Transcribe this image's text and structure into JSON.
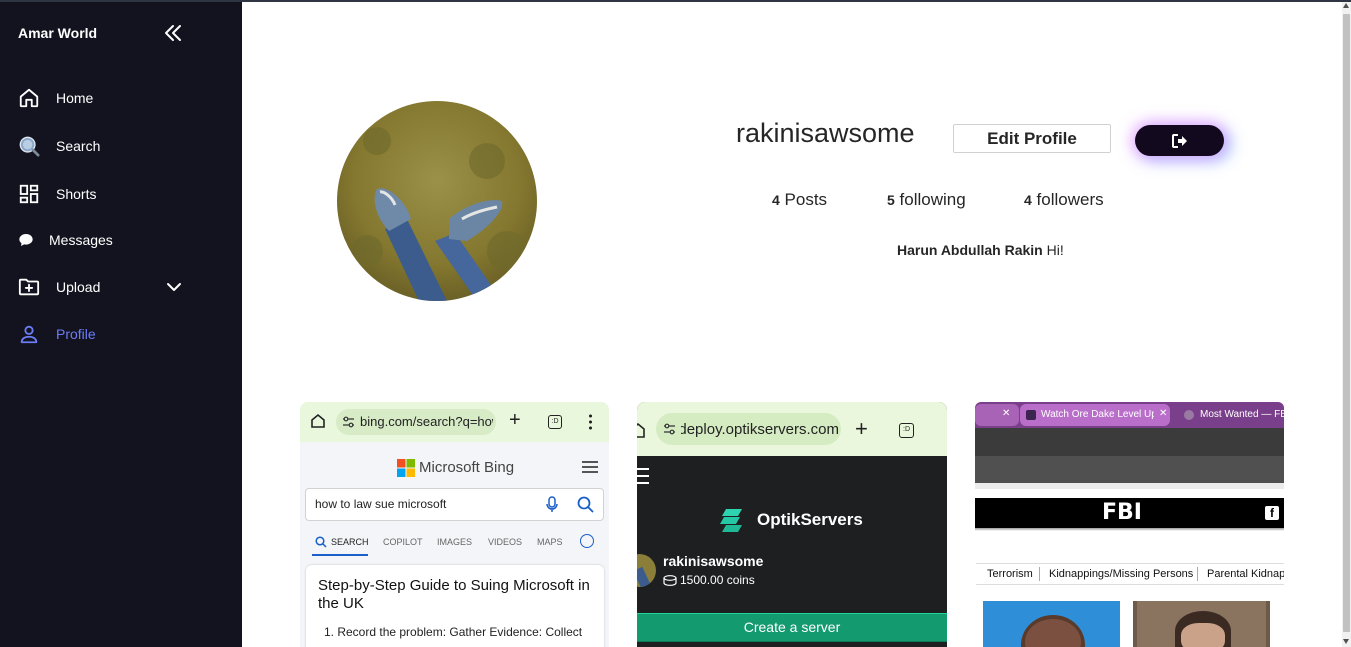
{
  "sidebar": {
    "brand": "Amar World",
    "items": [
      {
        "label": "Home",
        "icon": "home-icon"
      },
      {
        "label": "Search",
        "icon": "search-icon"
      },
      {
        "label": "Shorts",
        "icon": "grid-icon"
      },
      {
        "label": "Messages",
        "icon": "chat-bubble-icon"
      },
      {
        "label": "Upload",
        "icon": "folder-plus-icon"
      },
      {
        "label": "Profile",
        "icon": "user-icon"
      }
    ],
    "active_color": "#6b7cf6"
  },
  "profile": {
    "username": "rakinisawsome",
    "edit_label": "Edit Profile",
    "posts_count": "4",
    "posts_label": "Posts",
    "following_count": "5",
    "following_label": "following",
    "followers_count": "4",
    "followers_label": "followers",
    "full_name": "Harun Abdullah Rakin",
    "bio": "Hi!"
  },
  "posts": [
    {
      "url": "bing.com/search?q=how",
      "brand": "Microsoft Bing",
      "query": "how to law sue microsoft",
      "tabs": [
        "SEARCH",
        "COPILOT",
        "IMAGES",
        "VIDEOS",
        "MAPS"
      ],
      "result_title": "Step-by-Step Guide to Suing Microsoft in the UK",
      "result_line": "1. Record the problem: Gather Evidence: Collect"
    },
    {
      "url": "deploy.optikservers.com",
      "brand": "OptikServers",
      "user": "rakinisawsome",
      "coins": "1500.00 coins",
      "button": "Create a server"
    },
    {
      "tab1": "Watch Ore Dake Level Up",
      "tab2": "Most Wanted — FBI",
      "logo": "FBI",
      "nav": [
        "Terrorism",
        "Kidnappings/Missing Persons",
        "Parental Kidnap"
      ]
    }
  ]
}
